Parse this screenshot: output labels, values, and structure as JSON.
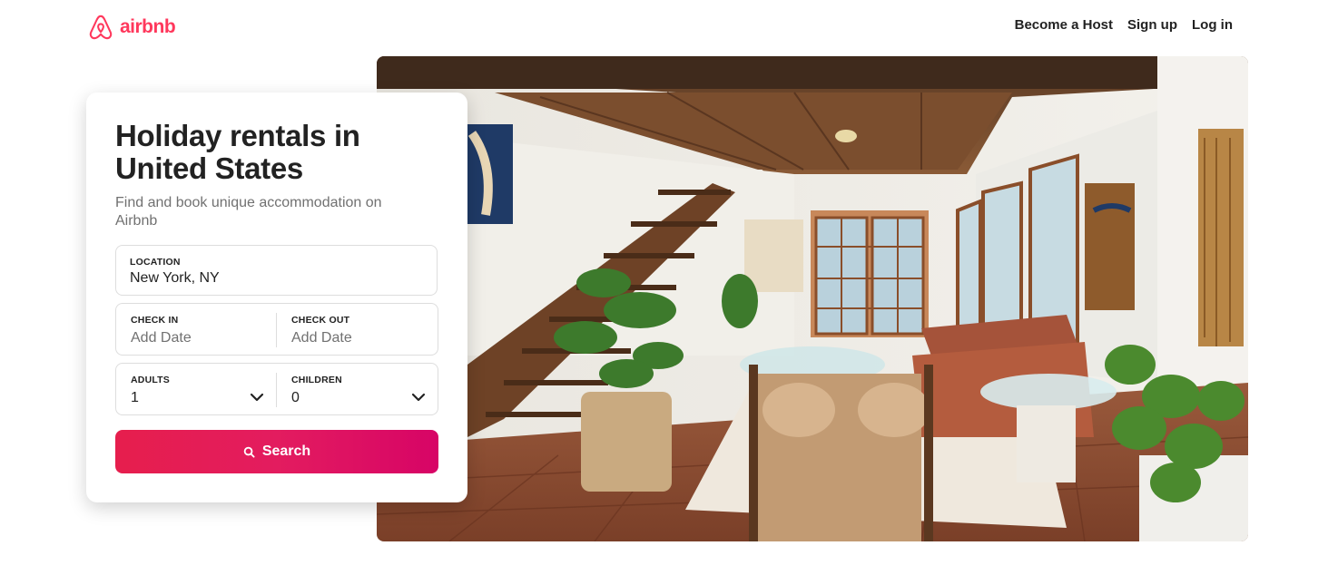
{
  "header": {
    "brand": "airbnb",
    "nav": {
      "become_host": "Become a Host",
      "sign_up": "Sign up",
      "log_in": "Log in"
    }
  },
  "search_card": {
    "title": "Holiday rentals in United States",
    "subtitle": "Find and book unique accommodation on Airbnb",
    "location": {
      "label": "LOCATION",
      "value": "New York, NY"
    },
    "check_in": {
      "label": "CHECK IN",
      "placeholder": "Add Date"
    },
    "check_out": {
      "label": "CHECK OUT",
      "placeholder": "Add Date"
    },
    "adults": {
      "label": "ADULTS",
      "value": "1"
    },
    "children": {
      "label": "CHILDREN",
      "value": "0"
    },
    "search_button": "Search"
  },
  "colors": {
    "brand": "#ff385c",
    "button_gradient_start": "#e61e4d",
    "button_gradient_end": "#d70466"
  }
}
